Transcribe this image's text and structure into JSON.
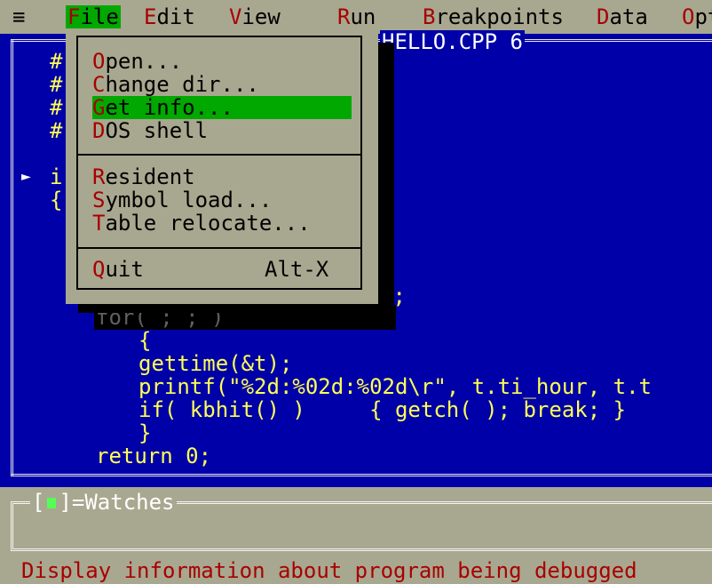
{
  "menubar": {
    "system_icon": "≡",
    "items": [
      {
        "hotkey": "F",
        "rest": "ile"
      },
      {
        "hotkey": "E",
        "rest": "dit"
      },
      {
        "hotkey": "V",
        "rest": "iew"
      },
      {
        "hotkey": "R",
        "rest": "un"
      },
      {
        "hotkey": "B",
        "rest": "reakpoints"
      },
      {
        "hotkey": "D",
        "rest": "ata"
      },
      {
        "hotkey": "O",
        "rest": "pt"
      }
    ]
  },
  "code_window": {
    "title": "HELLO.CPP 6",
    "lines": [
      "#",
      "#",
      "#",
      "#",
      "i",
      "{",
      ");",
      "for( ; ; )",
      "{",
      "gettime(&t);",
      "printf(\"%2d:%02d:%02d\\r\", t.ti_hour, t.t",
      "if( kbhit() )     { getch( ); break; }",
      "}",
      "return 0;"
    ],
    "exec_marker": "►"
  },
  "file_menu": {
    "items": [
      {
        "hotkey": "O",
        "rest": "pen..."
      },
      {
        "hotkey": "C",
        "rest": "hange dir..."
      },
      {
        "hotkey": "G",
        "rest": "et info...",
        "selected": true
      },
      {
        "hotkey": "D",
        "rest": "OS shell"
      },
      {
        "hotkey": "R",
        "rest": "esident"
      },
      {
        "hotkey": "S",
        "rest": "ymbol load..."
      },
      {
        "hotkey": "T",
        "rest": "able relocate..."
      },
      {
        "hotkey": "Q",
        "rest": "uit",
        "shortcut": "Alt-X"
      }
    ]
  },
  "watches": {
    "close_open": "[",
    "close_close": "]",
    "title": "=Watches"
  },
  "status_line": "Display information about program being debugged",
  "colors": {
    "menu_bg": "#a8a890",
    "code_bg": "#0000a8",
    "code_fg": "#ffff55",
    "highlight": "#00a800",
    "hotkey": "#a80000"
  }
}
